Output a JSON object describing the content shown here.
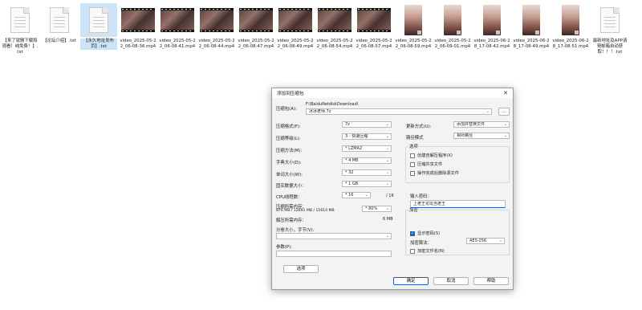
{
  "files": [
    {
      "kind": "doc",
      "name": "【来了就删下载和观看！纯免费！】.txt",
      "selected": false
    },
    {
      "kind": "doc",
      "name": "【论坛介绍】.txt",
      "selected": false
    },
    {
      "kind": "doc",
      "name": "【永久地址发布页】.txt",
      "selected": true
    },
    {
      "kind": "video",
      "name": "video_2025-05-22_06-08-36.mp4"
    },
    {
      "kind": "video",
      "name": "video_2025-05-22_06-08-41.mp4"
    },
    {
      "kind": "video",
      "name": "video_2025-05-22_06-08-44.mp4"
    },
    {
      "kind": "video",
      "name": "video_2025-05-22_06-08-47.mp4"
    },
    {
      "kind": "video",
      "name": "video_2025-05-22_06-08-49.mp4"
    },
    {
      "kind": "video",
      "name": "video_2025-05-22_06-08-54.mp4"
    },
    {
      "kind": "video",
      "name": "video_2025-05-22_06-08-57.mp4"
    },
    {
      "kind": "portrait",
      "name": "video_2025-05-22_06-08-59.mp4"
    },
    {
      "kind": "portrait",
      "name": "video_2025-05-22_06-09-01.mp4"
    },
    {
      "kind": "portrait",
      "name": "video_2025-06-28_17-08-42.mp4"
    },
    {
      "kind": "portrait",
      "name": "video_2025-06-28_17-08-49.mp4"
    },
    {
      "kind": "portrait",
      "name": "video_2025-06-28_17-08-51.mp4"
    },
    {
      "kind": "doc",
      "name": "最新地址及APP请発邮箱自动获取！！！.txt",
      "selected": false
    }
  ],
  "dialog": {
    "title": "添加到压缩包",
    "close_glyph": "✕",
    "archive_label": "压缩包(A):",
    "archive_path": "F:\\BaiduNetdiskDownload\\",
    "archive_name": "冰冰老师.7z",
    "browse_label": "...",
    "format_label": "压缩格式(F):",
    "format_value": "7z",
    "level_label": "压缩等级(L):",
    "level_value": "3 - 快速压缩",
    "method_label": "压缩方法(M):",
    "method_value": "* LZMA2",
    "dict_label": "字典大小(D):",
    "dict_value": "* 4 MB",
    "word_label": "单词大小(W):",
    "word_value": "* 32",
    "solid_label": "固实数据大小：",
    "solid_value": "* 1 GB",
    "cpu_label": "CPU线程数：",
    "cpu_value": "* 16",
    "cpu_total": "/ 16",
    "mem_label": "压缩所需内存：",
    "mem_detail": "876 MB / 12691 MB / 15614 MB",
    "mem_value": "* 80%",
    "decomp_mem_label": "解压所需内存：",
    "decomp_mem_value": "6 MB",
    "split_label": "分卷大小，字节(V):",
    "split_value": "",
    "params_label": "参数(P):",
    "params_value": "",
    "options_button": "选项",
    "update_label": "更新方式(U):",
    "update_value": "添加并替换文件",
    "pathmode_label": "路径模式",
    "pathmode_value": "相对路径",
    "options_group": "选项",
    "opt_sfx": "创建自解压程序(X)",
    "opt_shared": "压缩共享文件",
    "opt_delete": "操作完成后删除源文件",
    "encrypt_group": "加密",
    "password_label": "输入密码：",
    "password_value": "上老王论坛当老王",
    "show_password": "显示密码(S)",
    "enc_method_label": "加密算法：",
    "enc_method_value": "AES-256",
    "enc_names": "加密文件名(N)",
    "ok": "确定",
    "cancel": "取消",
    "help": "帮助"
  }
}
